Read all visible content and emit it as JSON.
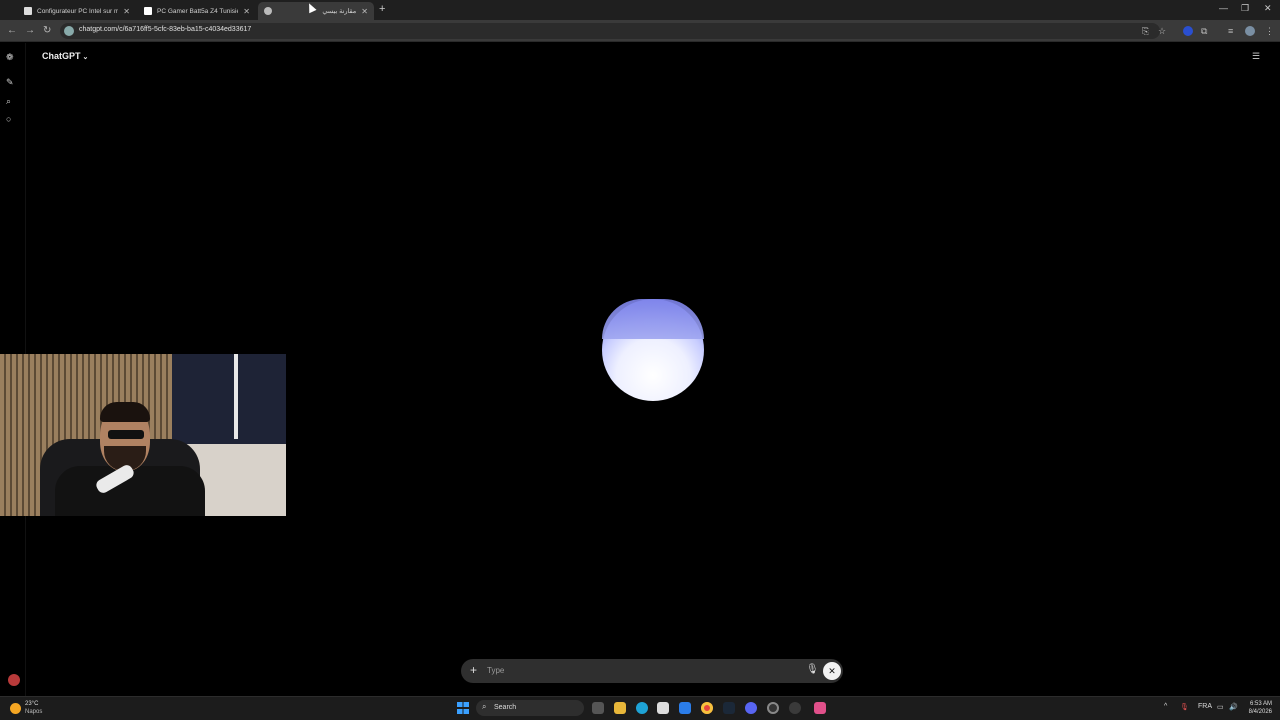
{
  "browser": {
    "tabs": [
      {
        "title": "Configurateur PC Intel sur mesure",
        "active": false
      },
      {
        "title": "PC Gamer Batt5a Z4 Tunisie -",
        "active": false
      },
      {
        "title": "مقارنة بيسي",
        "active": true
      }
    ],
    "url": "chatgpt.com/c/6a716ff5-5cfc-83eb-ba15-c4034ed33617",
    "new_tab_icon": "plus-icon"
  },
  "app": {
    "brand": "ChatGPT",
    "composer": {
      "placeholder": "Type"
    }
  },
  "taskbar": {
    "weather_temp": "23°C",
    "weather_city": "Napos",
    "search_label": "Search",
    "language": "FRA",
    "time": "6:53 AM",
    "date": "8/4/2026"
  },
  "colors": {
    "orb_top": "#7c82ea",
    "orb_bottom": "#ffffff",
    "background": "#000000"
  }
}
